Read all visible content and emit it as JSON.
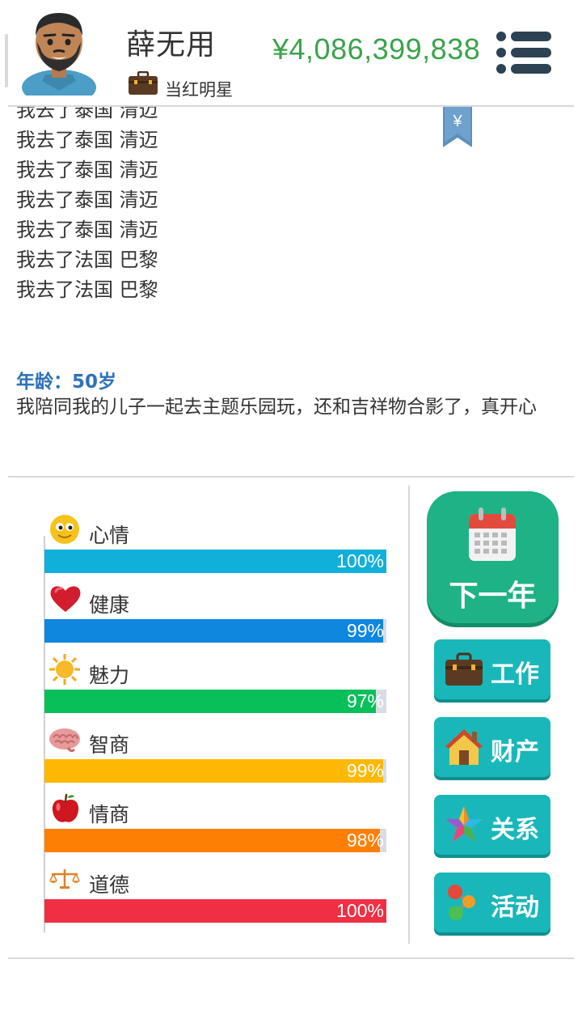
{
  "header": {
    "name": "薛无用",
    "occupation": "当红明星",
    "money": "¥4,086,399,838",
    "bookmark_symbol": "¥"
  },
  "log": {
    "lines": [
      "我去了泰国 清迈",
      "我去了泰国 清迈",
      "我去了泰国 清迈",
      "我去了泰国 清迈",
      "我去了泰国 清迈",
      "我去了法国 巴黎",
      "我去了法国 巴黎"
    ],
    "age": "年龄：50岁",
    "event": "我陪同我的儿子一起去主题乐园玩，还和吉祥物合影了，真开心"
  },
  "stats": [
    {
      "label": "心情",
      "value": 100,
      "value_text": "100%",
      "color": "#10b0db",
      "icon": "smiley-icon"
    },
    {
      "label": "健康",
      "value": 99,
      "value_text": "99%",
      "color": "#0f87df",
      "icon": "heart-icon"
    },
    {
      "label": "魅力",
      "value": 97,
      "value_text": "97%",
      "color": "#09bf5a",
      "icon": "sun-icon"
    },
    {
      "label": "智商",
      "value": 99,
      "value_text": "99%",
      "color": "#fdb804",
      "icon": "brain-icon"
    },
    {
      "label": "情商",
      "value": 98,
      "value_text": "98%",
      "color": "#fd7f03",
      "icon": "apple-icon"
    },
    {
      "label": "道德",
      "value": 100,
      "value_text": "100%",
      "color": "#ef2f44",
      "icon": "scales-icon"
    }
  ],
  "actions": {
    "next_year": "下一年",
    "work": "工作",
    "property": "财产",
    "relations": "关系",
    "activities": "活动"
  },
  "colors": {
    "money_green": "#3aa34a",
    "age_blue": "#2e72b8",
    "next_button": "#1fb286",
    "action_button": "#19b7b9"
  }
}
